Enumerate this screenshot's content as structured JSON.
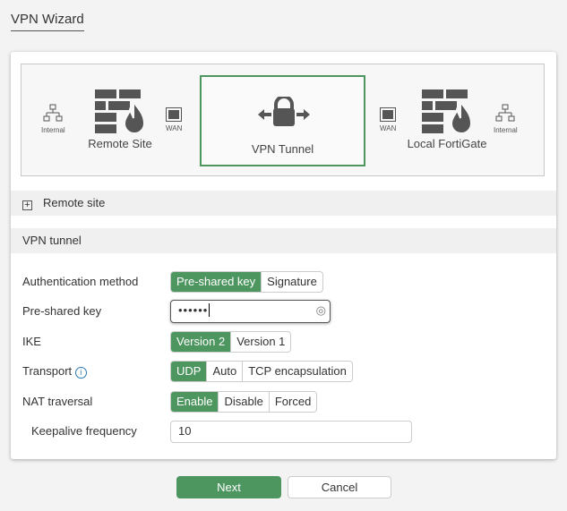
{
  "header": {
    "title": "VPN Wizard"
  },
  "diagram": {
    "remote_internal": "Internal",
    "remote_site": "Remote Site",
    "remote_wan": "WAN",
    "tunnel": "VPN Tunnel",
    "local_wan": "WAN",
    "local_fortigate": "Local FortiGate",
    "local_internal": "Internal"
  },
  "sections": {
    "remote_site": "Remote site",
    "vpn_tunnel": "VPN tunnel"
  },
  "form": {
    "auth_label": "Authentication method",
    "auth_options": [
      "Pre-shared key",
      "Signature"
    ],
    "psk_label": "Pre-shared key",
    "psk_value": "••••••",
    "ike_label": "IKE",
    "ike_options": [
      "Version 2",
      "Version 1"
    ],
    "transport_label": "Transport",
    "transport_options": [
      "UDP",
      "Auto",
      "TCP encapsulation"
    ],
    "nat_label": "NAT traversal",
    "nat_options": [
      "Enable",
      "Disable",
      "Forced"
    ],
    "keepalive_label": "Keepalive frequency",
    "keepalive_value": "10"
  },
  "buttons": {
    "next": "Next",
    "cancel": "Cancel"
  },
  "colors": {
    "accent": "#4e9660"
  }
}
